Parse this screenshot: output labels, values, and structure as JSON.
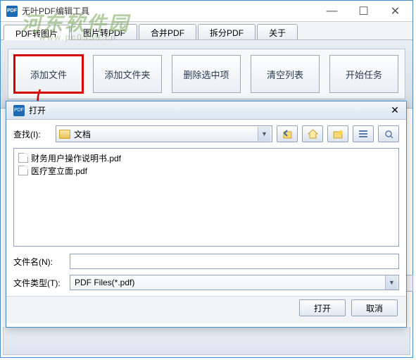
{
  "window": {
    "title": "无叶PDF编辑工具",
    "minimize": "—",
    "maximize": "☐",
    "close": "✕"
  },
  "watermark": {
    "main": "河东软件园",
    "sub": "www.pc0359.cn"
  },
  "tabs": [
    {
      "label": "PDF转图片"
    },
    {
      "label": "图片转PDF"
    },
    {
      "label": "合并PDF"
    },
    {
      "label": "拆分PDF"
    },
    {
      "label": "关于"
    }
  ],
  "toolbar": {
    "add_file": "添加文件",
    "add_folder": "添加文件夹",
    "delete_selected": "删除选中项",
    "clear_list": "清空列表",
    "start_task": "开始任务"
  },
  "dialog": {
    "title": "打开",
    "close": "✕",
    "lookin_label": "查找(I):",
    "lookin_value": "文档",
    "files": [
      {
        "name": "财务用户操作说明书.pdf"
      },
      {
        "name": "医疗室立面.pdf"
      }
    ],
    "filename_label": "文件名(N):",
    "filename_value": "",
    "filetype_label": "文件类型(T):",
    "filetype_value": "PDF Files(*.pdf)",
    "open_btn": "打开",
    "cancel_btn": "取消",
    "nav_icons": {
      "back": "back-icon",
      "home": "home-icon",
      "new_folder": "new-folder-icon",
      "list_view": "list-view-icon",
      "details_view": "details-view-icon"
    }
  }
}
